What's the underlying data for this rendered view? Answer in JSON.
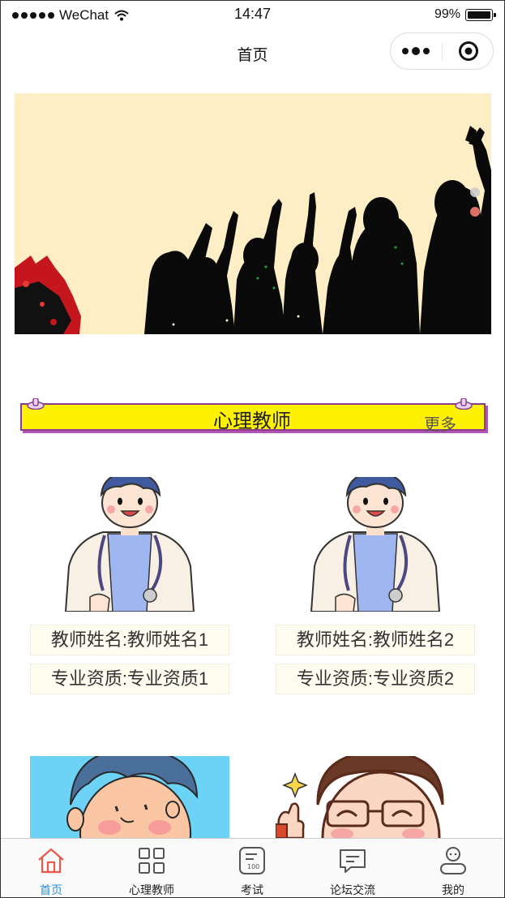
{
  "status_bar": {
    "carrier": "WeChat",
    "time": "14:47",
    "battery": "99%"
  },
  "nav": {
    "title": "首页"
  },
  "section": {
    "title": "心理教师",
    "more": "更多"
  },
  "teachers": [
    {
      "name_line": "教师姓名:教师姓名1",
      "qual_line": "专业资质:专业资质1"
    },
    {
      "name_line": "教师姓名:教师姓名2",
      "qual_line": "专业资质:专业资质2"
    }
  ],
  "tabbar": {
    "items": [
      {
        "label": "首页",
        "icon": "home-icon",
        "active": true
      },
      {
        "label": "心理教师",
        "icon": "grid-icon",
        "active": false
      },
      {
        "label": "考试",
        "icon": "exam-icon",
        "active": false
      },
      {
        "label": "论坛交流",
        "icon": "chat-icon",
        "active": false
      },
      {
        "label": "我的",
        "icon": "user-icon",
        "active": false
      }
    ]
  },
  "colors": {
    "accent": "#2d8fd8",
    "home_icon": "#e8584d",
    "section_bar": "#fff200",
    "section_border": "#8e3b8f",
    "banner_bg": "#fdeec6"
  }
}
